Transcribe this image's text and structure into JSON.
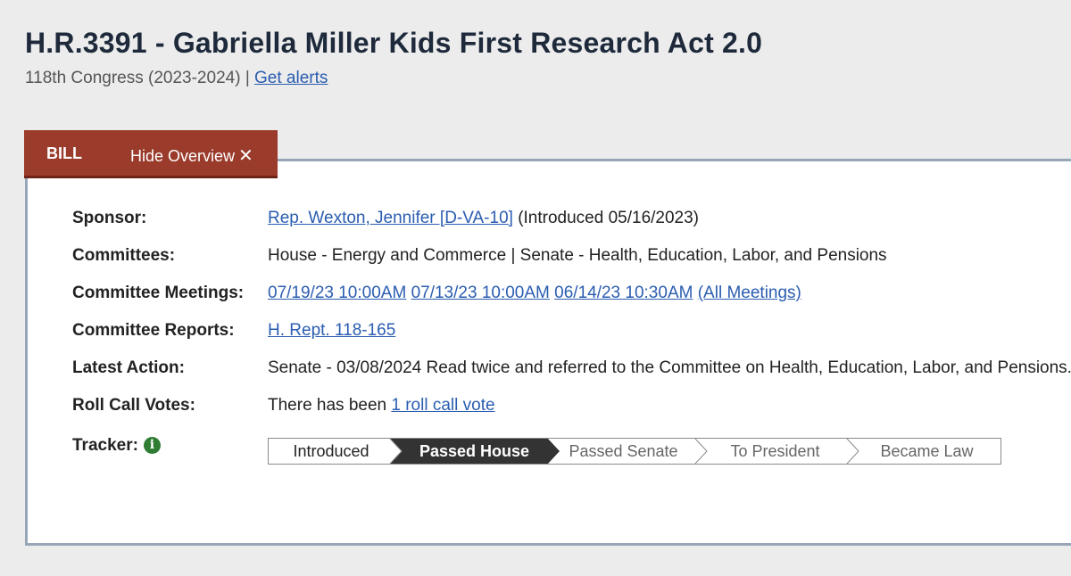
{
  "header": {
    "title": "H.R.3391 - Gabriella Miller Kids First Research Act 2.0",
    "congress": "118th Congress (2023-2024)",
    "separator": "|",
    "alerts_link": "Get alerts"
  },
  "tabs": {
    "bill": "BILL",
    "hide_overview": "Hide Overview",
    "hide_icon": "✕"
  },
  "overview": {
    "sponsor": {
      "label": "Sponsor:",
      "name": "Rep. Wexton, Jennifer [D-VA-10]",
      "introduced": " (Introduced 05/16/2023)"
    },
    "committees": {
      "label": "Committees:",
      "value": "House - Energy and Commerce | Senate - Health, Education, Labor, and Pensions"
    },
    "committee_meetings": {
      "label": "Committee Meetings:",
      "meetings": [
        "07/19/23 10:00AM",
        "07/13/23 10:00AM",
        "06/14/23 10:30AM"
      ],
      "all_link": "(All Meetings)"
    },
    "committee_reports": {
      "label": "Committee Reports:",
      "report": "H. Rept. 118-165"
    },
    "latest_action": {
      "label": "Latest Action:",
      "value": "Senate - 03/08/2024 Read twice and referred to the Committee on Health, Education, Labor, and Pensions."
    },
    "roll_call_votes": {
      "label": "Roll Call Votes:",
      "prefix": "There has been ",
      "link": "1 roll call vote"
    },
    "tracker": {
      "label": "Tracker:",
      "info_icon": "info-icon",
      "steps": [
        "Introduced",
        "Passed House",
        "Passed Senate",
        "To President",
        "Became Law"
      ],
      "current_step": "Passed House"
    }
  },
  "colors": {
    "tab_bg": "#9a3b2b",
    "link": "#2a5db0",
    "panel_border": "#96a6b8",
    "tracker_active": "#333333",
    "info_icon": "#2e7d32"
  }
}
